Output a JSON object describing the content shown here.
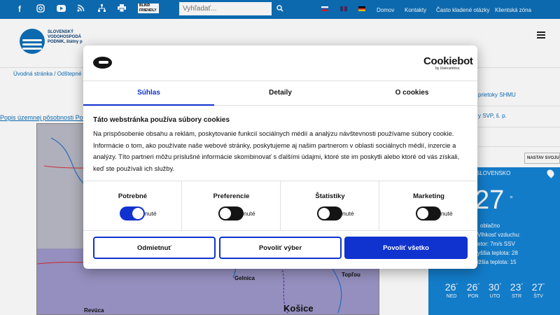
{
  "topbar": {
    "search_placeholder": "Vyhľadať...",
    "blind_label": "BLIND FRIENDLY",
    "links": [
      "Domov",
      "Kontakty",
      "Často kladené otázky",
      "Klientská zóna"
    ]
  },
  "header": {
    "logo_lines": [
      "SLOVENSKÝ",
      "VODOHOSPODÁ",
      "PODNIK, štátny p"
    ]
  },
  "breadcrumb": "Úvodná stránka / Odštepné z",
  "main": {
    "popis_link": "Popis územnej pôsobnosti Pov",
    "map_labels": [
      "Gelnica",
      "Topľou",
      "Revúca",
      "Košice"
    ]
  },
  "right": {
    "link1": "prietoky SHMU",
    "link2": "y SVP, š. p.",
    "nastav": "NASTAV SVOJU"
  },
  "weather": {
    "title": "SLOVENSKO",
    "temp": "27",
    "deg": "°",
    "condition": "oblačno",
    "humidity": "Vlhkosť vzduchu:",
    "wind": "etor: 7m/s SSV",
    "max": "yššia teplota: 28",
    "min": "ižšia teplota: 15",
    "forecast": [
      {
        "temp": "26",
        "day": "NED"
      },
      {
        "temp": "26",
        "day": "PON"
      },
      {
        "temp": "30",
        "day": "UTO"
      },
      {
        "temp": "23",
        "day": "STR"
      },
      {
        "temp": "27",
        "day": "ŠTV"
      }
    ]
  },
  "dialog": {
    "brand": "Cookiebot",
    "brand_sub": "by Usercentrics",
    "tabs": [
      "Súhlas",
      "Detaily",
      "O cookies"
    ],
    "heading": "Táto webstránka používa súbory cookies",
    "body": "Na prispôsobenie obsahu a reklám, poskytovanie funkcií sociálnych médií a analýzu návštevnosti používame súbory cookie. Informácie o tom, ako používate naše webové stránky, poskytujeme aj našim partnerom v oblasti sociálnych médií, inzercie a analýzy. Títo partneri môžu príslušné informácie skombinovať s ďalšími údajmi, ktoré ste im poskytli alebo ktoré od vás získali, keď ste používali ich služby.",
    "categories": [
      {
        "label": "Potrebné",
        "state": "nuté"
      },
      {
        "label": "Preferencie",
        "state": "nuté"
      },
      {
        "label": "Štatistiky",
        "state": "nuté"
      },
      {
        "label": "Marketing",
        "state": "nuté"
      }
    ],
    "buttons": {
      "deny": "Odmietnuť",
      "selection": "Povoliť výber",
      "all": "Povoliť všetko"
    }
  }
}
